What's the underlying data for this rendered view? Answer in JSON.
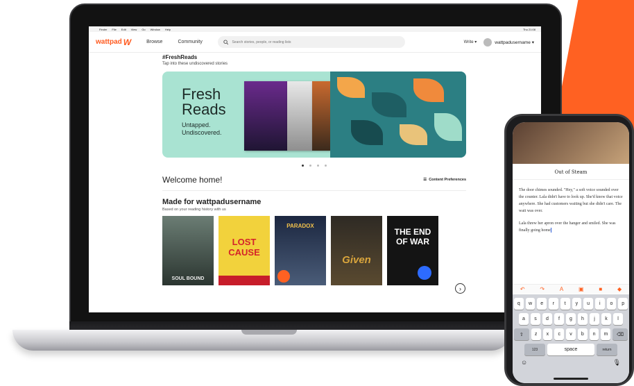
{
  "menubar": {
    "items": [
      "Finder",
      "File",
      "Edit",
      "View",
      "Go",
      "Window",
      "Help"
    ],
    "right": "Thu 21:08"
  },
  "nav": {
    "logo": "wattpad",
    "browse": "Browse",
    "community": "Community",
    "search_placeholder": "Search stories, people, or reading lists",
    "write": "Write ▾",
    "username": "wattpadusername ▾"
  },
  "fresh": {
    "title": "#FreshReads",
    "subtitle": "Tap into these undiscovered stories"
  },
  "banner": {
    "line1": "Fresh",
    "line2": "Reads",
    "tag1": "Untapped.",
    "tag2": "Undiscovered."
  },
  "welcome": {
    "heading": "Welcome home!",
    "prefs": "Content Preferences"
  },
  "made": {
    "title": "Made for wattpadusername",
    "subtitle": "Based on your reading history with us"
  },
  "covers": [
    {
      "title": "SOUL BOUND",
      "color": "#4a5a52"
    },
    {
      "title": "LOST CAUSE",
      "color": "#f2d23c"
    },
    {
      "title": "PARADOX",
      "color": "#2c3a52"
    },
    {
      "title": "Given",
      "color": "#3a3328"
    },
    {
      "title": "THE END OF WAR",
      "color": "#141414"
    }
  ],
  "phone": {
    "title": "Out of Steam",
    "para1": "The door chimes sounded. \"Hey,\" a soft voice sounded over the counter. Lala didn't have to look up. She'd know that voice anywhere. She had customers waiting but she didn't care. The wait was over.",
    "para2": "Lala threw her apron over the hanger and smiled. She was finally going home",
    "keys_row1": [
      "q",
      "w",
      "e",
      "r",
      "t",
      "y",
      "u",
      "i",
      "o",
      "p"
    ],
    "keys_row2": [
      "a",
      "s",
      "d",
      "f",
      "g",
      "h",
      "j",
      "k",
      "l"
    ],
    "keys_row3": [
      "z",
      "x",
      "c",
      "v",
      "b",
      "n",
      "m"
    ],
    "key_123": "123",
    "key_space": "space",
    "key_return": "return"
  },
  "colors": {
    "brand": "#ff6122",
    "banner_bg": "#a9e3d2"
  }
}
